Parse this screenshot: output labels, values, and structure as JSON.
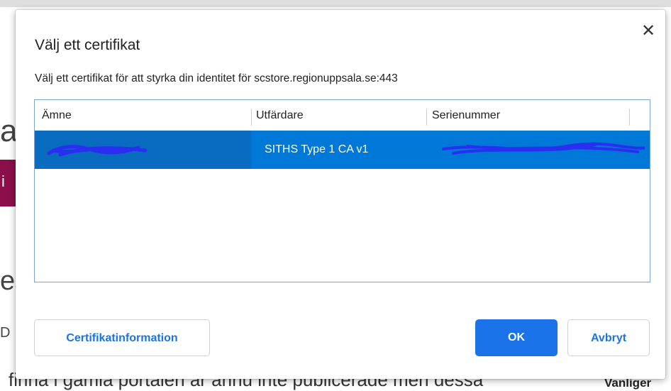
{
  "background_page": {
    "letter_a": "a",
    "letter_e": "e",
    "letter_d": "D",
    "band_letter": "i",
    "bottom_text": "finna i gamla portalen är ännu inte publicerade men dessa",
    "bottom_right": "Vanliger"
  },
  "dialog": {
    "title": "Välj ett certifikat",
    "description": "Välj ett certifikat för att styrka din identitet för scstore.regionuppsala.se:443",
    "close_icon": "close-icon",
    "table": {
      "columns": [
        "Ämne",
        "Utfärdare",
        "Serienummer"
      ],
      "rows": [
        {
          "subject": "",
          "issuer": "SITHS Type 1 CA v1",
          "serial": "",
          "selected": true
        }
      ]
    },
    "buttons": {
      "info": "Certifikatinformation",
      "ok": "OK",
      "cancel": "Avbryt"
    },
    "colors": {
      "selection": "#0078d7",
      "primary": "#1a73e8",
      "redaction": "#2a2ef0",
      "background_band": "#8a0f4a"
    }
  }
}
